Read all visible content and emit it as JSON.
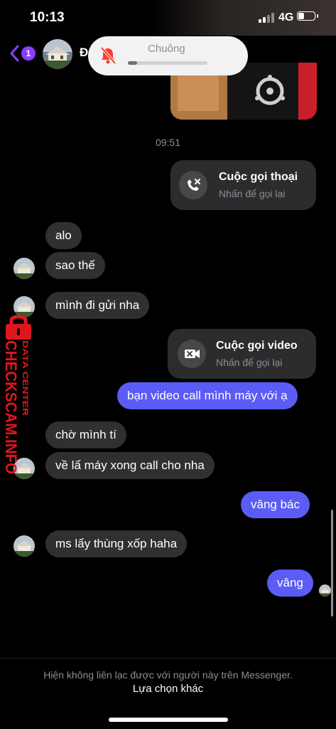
{
  "status_bar": {
    "time": "10:13",
    "network": "4G"
  },
  "header": {
    "back_badge": "1",
    "contact_initial": "Đ",
    "back_icon": "chevron-left-icon",
    "accent_color": "#8a3ffc"
  },
  "ringer_popup": {
    "label": "Chuông",
    "icon": "bell-slash-icon",
    "level": 0.12
  },
  "conversation": {
    "time_separator": "09:51",
    "voice_call": {
      "title": "Cuộc gọi thoại",
      "subtitle": "Nhấn để gọi lại",
      "icon": "phone-missed-icon"
    },
    "messages_1": [
      {
        "text": "alo"
      },
      {
        "text": "sao thế"
      },
      {
        "text": "mình đi gửi nha"
      }
    ],
    "video_call": {
      "title": "Cuộc gọi video",
      "subtitle": "Nhấn để gọi lại",
      "icon": "video-missed-icon"
    },
    "sent_1": "bạn video call mình máy với ạ",
    "messages_2": [
      {
        "text": "chờ mình tí"
      },
      {
        "text": "về lấ máy xong call cho nha"
      }
    ],
    "sent_2": "vâng bác",
    "message_3": "ms lấy thùng xốp haha",
    "sent_3": "vâng",
    "outgoing_color": "#5b5cf5",
    "incoming_color": "#303030"
  },
  "watermark": {
    "main": "CHECKSCAM.INFO",
    "sub": "DATA CENTER",
    "icon": "lock-icon",
    "color": "#e0161e"
  },
  "footer": {
    "message": "Hiện không liên lạc được với người này trên Messenger.",
    "action": "Lựa chọn khác"
  }
}
